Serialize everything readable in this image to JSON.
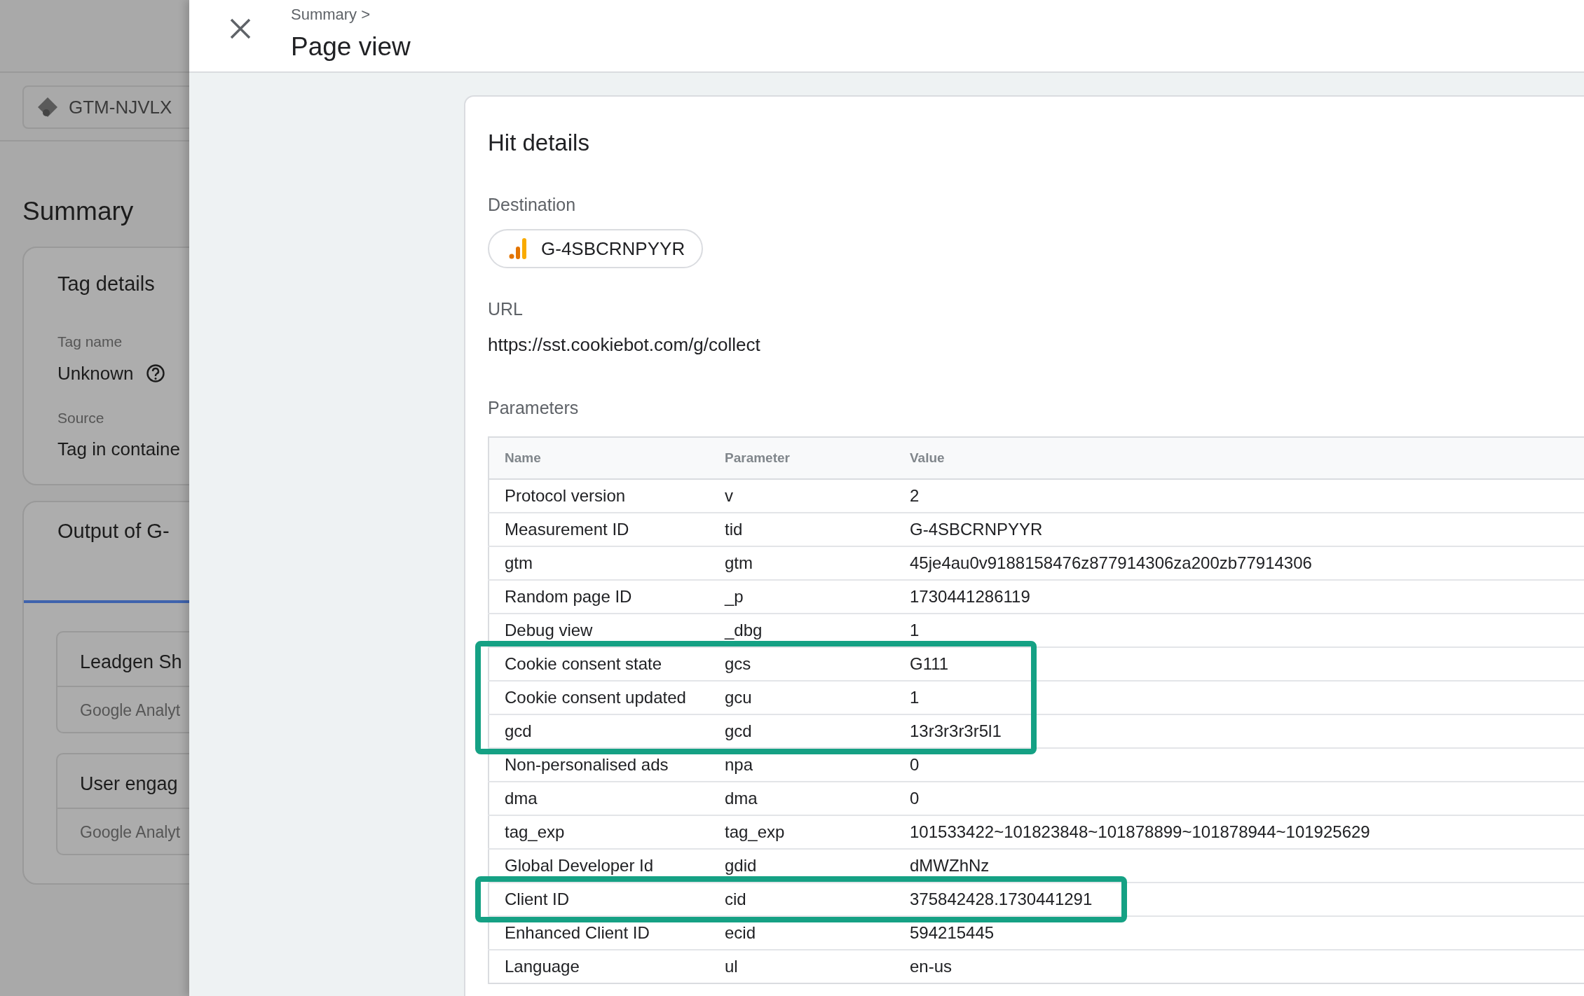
{
  "background": {
    "container_id": "GTM-NJVLX",
    "title": "Summary",
    "tag_details": {
      "title": "Tag details",
      "fields": [
        {
          "label": "Tag name",
          "value": "Unknown",
          "help": true
        },
        {
          "label": "Source",
          "value": "Tag in containe"
        }
      ]
    },
    "output": {
      "title": "Output of G-",
      "tags": [
        {
          "name": "Leadgen Sh",
          "type": "Google Analyt"
        },
        {
          "name": "User engag",
          "type": "Google Analyt"
        }
      ]
    }
  },
  "drawer": {
    "breadcrumb": "Summary >",
    "title": "Page view",
    "hit_details": {
      "title": "Hit details",
      "destination_label": "Destination",
      "destination": "G-4SBCRNPYYR",
      "url_label": "URL",
      "url": "https://sst.cookiebot.com/g/collect",
      "parameters_label": "Parameters",
      "columns": [
        "Name",
        "Parameter",
        "Value"
      ],
      "rows": [
        {
          "name": "Protocol version",
          "parameter": "v",
          "value": "2",
          "highlighted": false
        },
        {
          "name": "Measurement ID",
          "parameter": "tid",
          "value": "G-4SBCRNPYYR",
          "highlighted": false
        },
        {
          "name": "gtm",
          "parameter": "gtm",
          "value": "45je4au0v9188158476z877914306za200zb77914306",
          "highlighted": false
        },
        {
          "name": "Random page ID",
          "parameter": "_p",
          "value": "1730441286119",
          "highlighted": false
        },
        {
          "name": "Debug view",
          "parameter": "_dbg",
          "value": "1",
          "highlighted": false
        },
        {
          "name": "Cookie consent state",
          "parameter": "gcs",
          "value": "G111",
          "highlighted": true
        },
        {
          "name": "Cookie consent updated",
          "parameter": "gcu",
          "value": "1",
          "highlighted": true
        },
        {
          "name": "gcd",
          "parameter": "gcd",
          "value": "13r3r3r3r5l1",
          "highlighted": true
        },
        {
          "name": "Non-personalised ads",
          "parameter": "npa",
          "value": "0",
          "highlighted": false
        },
        {
          "name": "dma",
          "parameter": "dma",
          "value": "0",
          "highlighted": false
        },
        {
          "name": "tag_exp",
          "parameter": "tag_exp",
          "value": "101533422~101823848~101878899~101878944~101925629",
          "highlighted": false
        },
        {
          "name": "Global Developer Id",
          "parameter": "gdid",
          "value": "dMWZhNz",
          "highlighted": false
        },
        {
          "name": "Client ID",
          "parameter": "cid",
          "value": "375842428.1730441291",
          "highlighted": true
        },
        {
          "name": "Enhanced Client ID",
          "parameter": "ecid",
          "value": "594215445",
          "highlighted": false
        },
        {
          "name": "Language",
          "parameter": "ul",
          "value": "en-us",
          "highlighted": false
        }
      ]
    }
  }
}
